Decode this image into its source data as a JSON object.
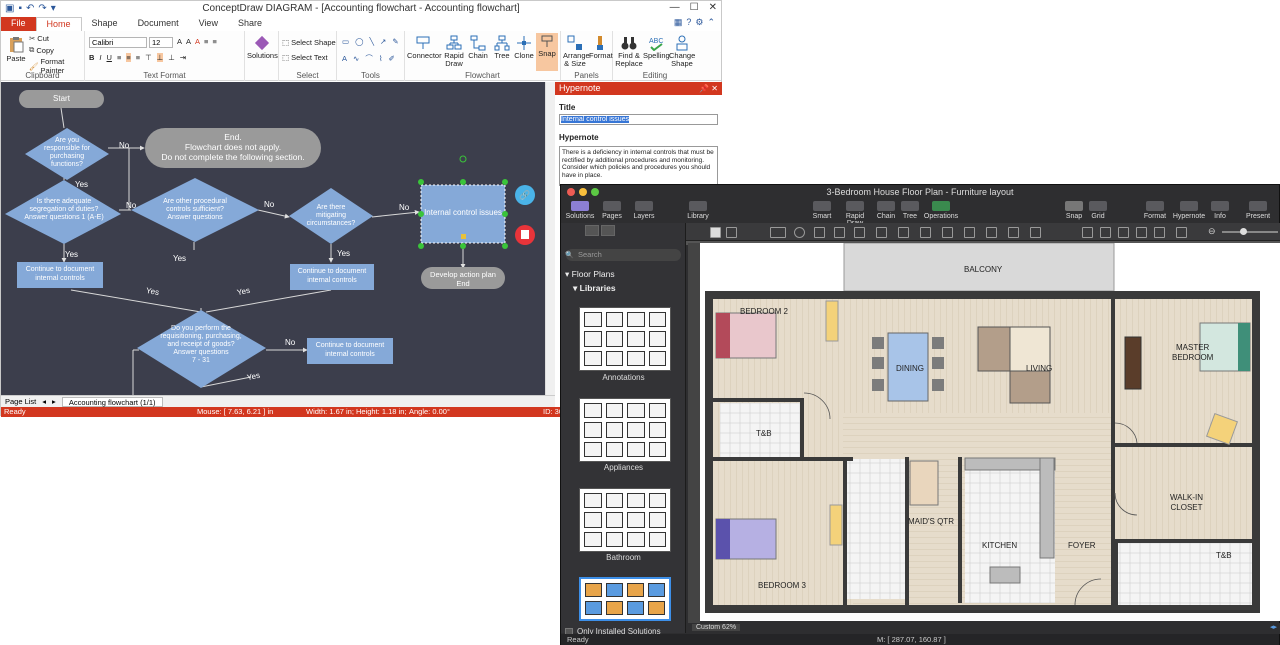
{
  "app1": {
    "title": "ConceptDraw DIAGRAM - [Accounting flowchart - Accounting flowchart]",
    "tabs": [
      "File",
      "Home",
      "Shape",
      "Document",
      "View",
      "Share"
    ],
    "ribbon": {
      "clipboard": {
        "label": "Clipboard",
        "paste": "Paste",
        "cut": "Cut",
        "copy": "Copy",
        "format_painter": "Format Painter"
      },
      "text_format": {
        "label": "Text Format",
        "font": "Calibri",
        "size": "12"
      },
      "solutions": "Solutions",
      "select": {
        "label": "Select",
        "select_shape": "Select Shape",
        "select_text": "Select Text"
      },
      "tools_label": "Tools",
      "flowchart": {
        "label": "Flowchart",
        "connector": "Connector",
        "rapid_draw": "Rapid Draw",
        "chain": "Chain",
        "tree": "Tree",
        "clone": "Clone",
        "snap": "Snap"
      },
      "panels": {
        "label": "Panels",
        "arrange_size": "Arrange & Size",
        "format": "Format"
      },
      "editing": {
        "label": "Editing",
        "find_replace": "Find & Replace",
        "spelling": "Spelling",
        "change_shape": "Change Shape"
      }
    },
    "flowchart": {
      "start": "Start",
      "end_box": "End.\nFlowchart does not apply.\nDo not complete the following section.",
      "d1": "Are you responsible for purchasing functions?",
      "d2": "Is there adequate segregation of duties? Answer questions 1 (A-E)",
      "d3": "Are other procedural controls sufficient? Answer questions",
      "d4": "Are there mitigating circumstances?",
      "selected": "Internal control issues",
      "develop": "Develop action plan\nEnd",
      "cont1": "Continue to document internal controls",
      "cont2": "Continue to document internal controls",
      "cont3": "Continue to document internal controls",
      "d5": "Do you perform the requisitioning, purchasing, and receipt of goods? Answer questions\n7 - 31",
      "labels": {
        "no": "No",
        "yes": "Yes"
      }
    },
    "page_list": "Page List",
    "page_tab": "Accounting flowchart (1/1)",
    "status": {
      "ready": "Ready",
      "mouse": "Mouse: [ 7.63, 6.21 ] in",
      "width": "Width: 1.67 in;",
      "height": "Height: 1.18 in;",
      "angle": "Angle: 0.00°",
      "id": "ID: 30"
    },
    "hypernote": {
      "header": "Hypernote",
      "title_label": "Title",
      "title_value": "Internal control issues",
      "hypernote_label": "Hypernote",
      "text": "There is a deficiency in internal controls that must be rectified by additional procedures and monitoring.\nConsider which policies and procedures you should have in place."
    }
  },
  "app2": {
    "title": "3-Bedroom House Floor Plan - Furniture layout",
    "toolbar": {
      "solutions": "Solutions",
      "pages": "Pages",
      "layers": "Layers",
      "library": "Library",
      "smart": "Smart",
      "rapid_draw": "Rapid Draw",
      "chain": "Chain",
      "tree": "Tree",
      "operations": "Operations",
      "snap": "Snap",
      "grid": "Grid",
      "format": "Format",
      "hypernote": "Hypernote",
      "info": "Info",
      "present": "Present"
    },
    "sidebar": {
      "search_placeholder": "Search",
      "floor_plans": "Floor Plans",
      "libraries": "Libraries",
      "libs": [
        "Annotations",
        "Appliances",
        "Bathroom"
      ],
      "only_installed": "Only Installed Solutions"
    },
    "rooms": {
      "balcony": "BALCONY",
      "bedroom2": "BEDROOM 2",
      "dining": "DINING",
      "living": "LIVING",
      "master": "MASTER\nBEDROOM",
      "tb1": "T&B",
      "tb2": "T&B",
      "maids": "MAID'S QTR",
      "kitchen": "KITCHEN",
      "foyer": "FOYER",
      "walkin": "WALK-IN\nCLOSET",
      "bedroom3": "BEDROOM 3"
    },
    "zoom": "Custom 62%",
    "status": {
      "ready": "Ready",
      "mouse": "M: [ 287.07, 160.87 ]"
    }
  }
}
